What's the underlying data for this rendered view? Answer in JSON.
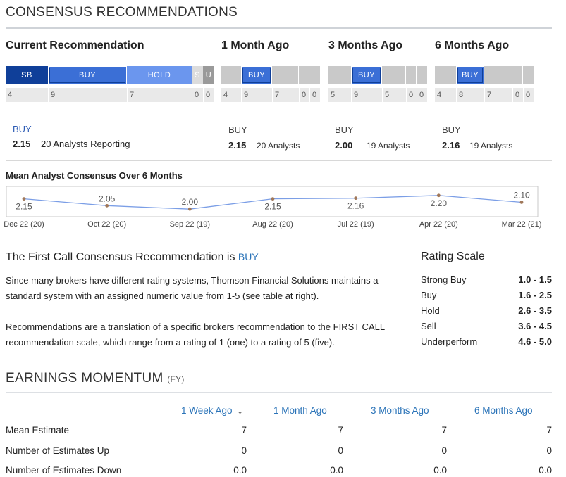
{
  "consensus": {
    "title": "CONSENSUS RECOMMENDATIONS",
    "columns": [
      {
        "heading": "Current Recommendation",
        "bar": [
          {
            "label": "SB",
            "count": "4",
            "weight": 60
          },
          {
            "label": "BUY",
            "count": "9",
            "weight": 112
          },
          {
            "label": "HOLD",
            "count": "7",
            "weight": 92
          },
          {
            "label": "S",
            "count": "0",
            "weight": 16
          },
          {
            "label": "U",
            "count": "0",
            "weight": 16
          }
        ],
        "rating": "BUY",
        "score": "2.15",
        "analysts": "20 Analysts Reporting"
      },
      {
        "heading": "1 Month Ago",
        "bar_counts": [
          "4",
          "9",
          "7",
          "0",
          "0"
        ],
        "rating": "BUY",
        "score": "2.15",
        "analysts": "20 Analysts"
      },
      {
        "heading": "3 Months Ago",
        "bar_counts": [
          "5",
          "9",
          "5",
          "0",
          "0"
        ],
        "rating": "BUY",
        "score": "2.00",
        "analysts": "19 Analysts"
      },
      {
        "heading": "6 Months Ago",
        "bar_counts": [
          "4",
          "8",
          "7",
          "0",
          "0"
        ],
        "rating": "BUY",
        "score": "2.16",
        "analysts": "19 Analysts"
      }
    ],
    "active_label": "BUY"
  },
  "trend": {
    "title": "Mean Analyst Consensus Over 6 Months"
  },
  "chart_data": {
    "type": "line",
    "title": "Mean Analyst Consensus Over 6 Months",
    "categories": [
      "Dec 22 (20)",
      "Oct 22 (20)",
      "Sep 22 (19)",
      "Aug 22 (20)",
      "Jul 22 (19)",
      "Apr 22 (20)",
      "Mar 22 (21)"
    ],
    "values": [
      2.15,
      2.05,
      2.0,
      2.15,
      2.16,
      2.2,
      2.1
    ],
    "value_labels": [
      "2.15",
      "2.05",
      "2.00",
      "2.15",
      "2.16",
      "2.20",
      "2.10"
    ],
    "label_position": [
      "below",
      "above",
      "above",
      "below",
      "below",
      "below",
      "above"
    ],
    "ylim": [
      1.93,
      2.28
    ],
    "grid": false,
    "colors": {
      "line": "#7b9ee6",
      "marker": "#a0785a"
    }
  },
  "first_call": {
    "title_prefix": "The First Call Consensus Recommendation is",
    "rating": "BUY",
    "paragraph1": "Since many brokers have different rating systems, Thomson Financial Solutions maintains a standard system with an assigned numeric value from 1-5 (see table at right).",
    "paragraph2": "Recommendations are a translation of a specific brokers recommendation to the FIRST CALL recommendation scale, which range from a rating of 1 (one) to a rating of 5 (five)."
  },
  "rating_scale": {
    "title": "Rating Scale",
    "rows": [
      {
        "name": "Strong Buy",
        "range": "1.0 - 1.5"
      },
      {
        "name": "Buy",
        "range": "1.6 - 2.5"
      },
      {
        "name": "Hold",
        "range": "2.6 - 3.5"
      },
      {
        "name": "Sell",
        "range": "3.6 - 4.5"
      },
      {
        "name": "Underperform",
        "range": "4.6 - 5.0"
      }
    ]
  },
  "earnings": {
    "title": "EARNINGS MOMENTUM",
    "suffix": "(FY)",
    "headers": [
      "1 Week Ago",
      "1 Month Ago",
      "3 Months Ago",
      "6 Months Ago"
    ],
    "sort_icon": "chevron-down-icon",
    "rows": [
      {
        "label": "Mean Estimate",
        "values": [
          "7",
          "7",
          "7",
          "7"
        ]
      },
      {
        "label": "Number of Estimates Up",
        "values": [
          "0",
          "0",
          "0",
          "0"
        ]
      },
      {
        "label": "Number of Estimates Down",
        "values": [
          "0.0",
          "0.0",
          "0.0",
          "0.0"
        ]
      }
    ]
  },
  "colors": {
    "sb": "#0f3f99",
    "buy": "#3b6fd6",
    "hold": "#6b96ee",
    "sell": "#dcdcdc",
    "under": "#9a9a9a",
    "link": "#2a73b8"
  }
}
